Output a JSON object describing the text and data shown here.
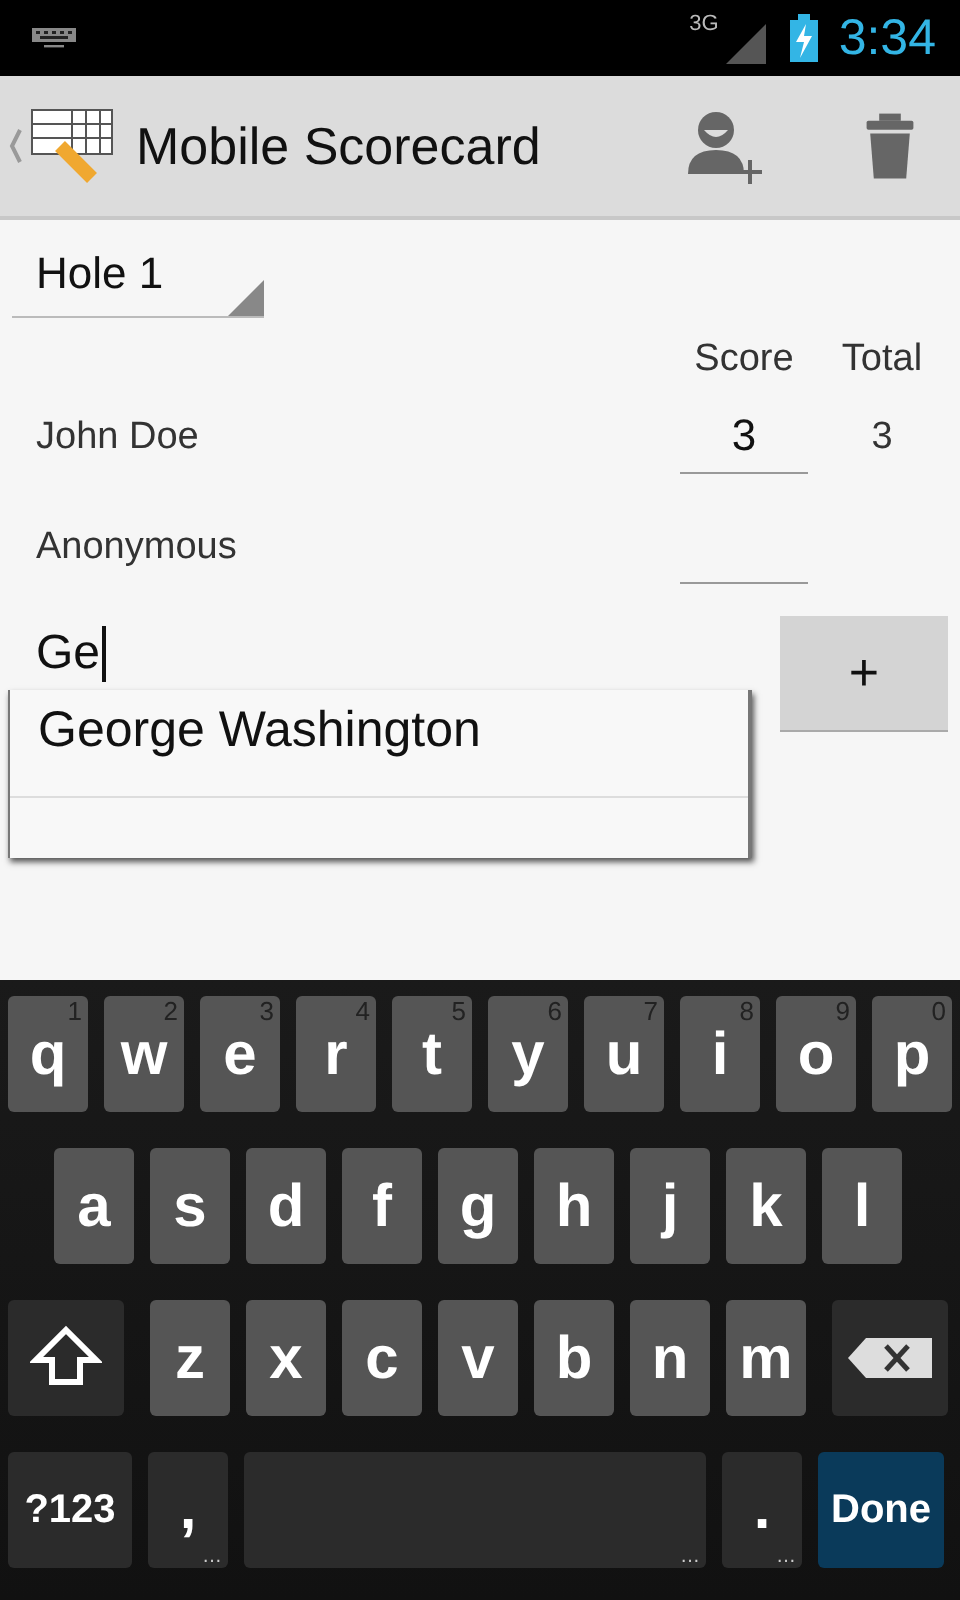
{
  "status_bar": {
    "network": "3G",
    "time": "3:34"
  },
  "action_bar": {
    "title": "Mobile Scorecard"
  },
  "hole_spinner": {
    "value": "Hole 1"
  },
  "table": {
    "columns": [
      "Score",
      "Total"
    ],
    "rows": [
      {
        "player": "John Doe",
        "score": "3",
        "total": "3"
      },
      {
        "player": "Anonymous",
        "score": "",
        "total": ""
      }
    ]
  },
  "new_player": {
    "value": "Ge",
    "add_button": "+"
  },
  "suggestions": [
    "George Washington"
  ],
  "keyboard": {
    "key_rows": [
      {
        "keys": [
          {
            "kind": "letter",
            "label": "q",
            "hint": "1"
          },
          {
            "kind": "letter",
            "label": "w",
            "hint": "2"
          },
          {
            "kind": "letter",
            "label": "e",
            "hint": "3"
          },
          {
            "kind": "letter",
            "label": "r",
            "hint": "4"
          },
          {
            "kind": "letter",
            "label": "t",
            "hint": "5"
          },
          {
            "kind": "letter",
            "label": "y",
            "hint": "6"
          },
          {
            "kind": "letter",
            "label": "u",
            "hint": "7"
          },
          {
            "kind": "letter",
            "label": "i",
            "hint": "8"
          },
          {
            "kind": "letter",
            "label": "o",
            "hint": "9"
          },
          {
            "kind": "letter",
            "label": "p",
            "hint": "0"
          }
        ]
      },
      {
        "keys": [
          {
            "kind": "letter",
            "label": "a"
          },
          {
            "kind": "letter",
            "label": "s"
          },
          {
            "kind": "letter",
            "label": "d"
          },
          {
            "kind": "letter",
            "label": "f"
          },
          {
            "kind": "letter",
            "label": "g"
          },
          {
            "kind": "letter",
            "label": "h"
          },
          {
            "kind": "letter",
            "label": "j"
          },
          {
            "kind": "letter",
            "label": "k"
          },
          {
            "kind": "letter",
            "label": "l"
          }
        ]
      },
      {
        "keys": [
          {
            "kind": "shift"
          },
          {
            "kind": "letter",
            "label": "z"
          },
          {
            "kind": "letter",
            "label": "x"
          },
          {
            "kind": "letter",
            "label": "c"
          },
          {
            "kind": "letter",
            "label": "v"
          },
          {
            "kind": "letter",
            "label": "b"
          },
          {
            "kind": "letter",
            "label": "n"
          },
          {
            "kind": "letter",
            "label": "m"
          },
          {
            "kind": "backspace"
          }
        ]
      },
      {
        "keys": [
          {
            "kind": "symbols",
            "label": "?123"
          },
          {
            "kind": "comma",
            "label": ",",
            "hint": "…"
          },
          {
            "kind": "space",
            "hint": "…"
          },
          {
            "kind": "period",
            "label": ".",
            "hint": "…"
          },
          {
            "kind": "done",
            "label": "Done"
          }
        ]
      }
    ]
  }
}
